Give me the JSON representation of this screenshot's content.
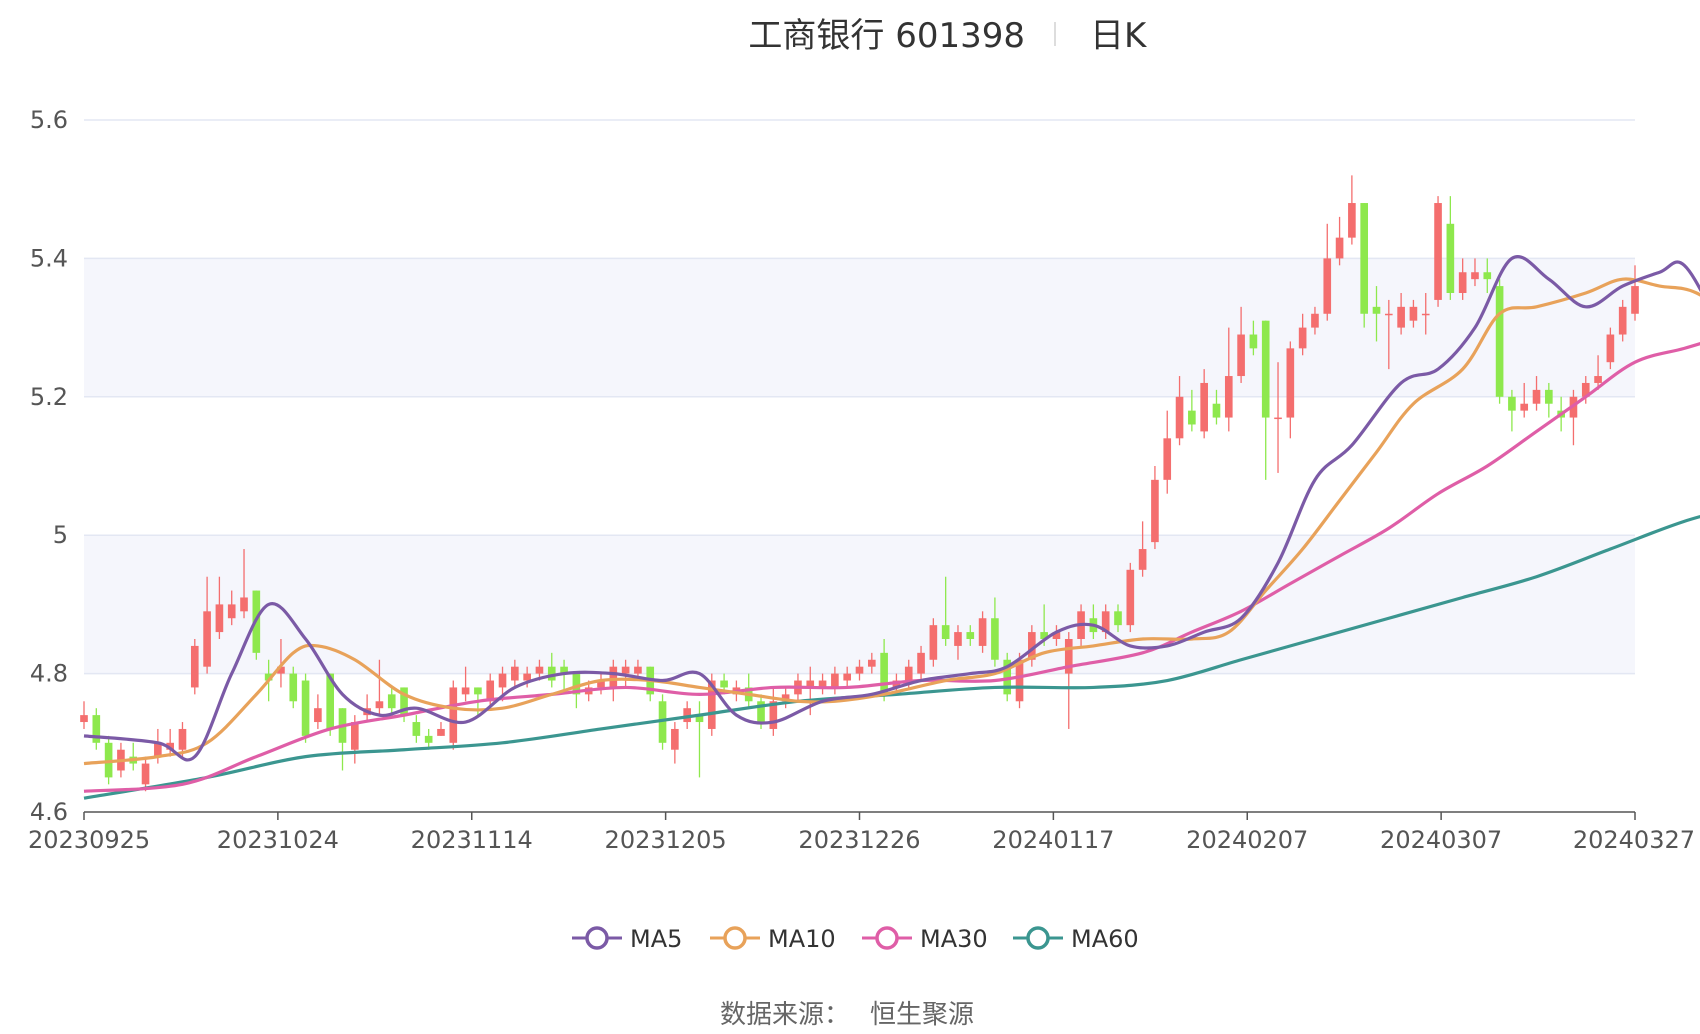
{
  "header": {
    "stock_name_code": "工商银行 601398",
    "period": "日K"
  },
  "footer": {
    "source_label": "数据来源：",
    "source_name": "恒生聚源"
  },
  "colors": {
    "up": "#f46e6e",
    "down": "#8ee84d",
    "grid": "#e3e7f3",
    "band": "#f5f6fc",
    "axis": "#555555",
    "MA5": "#7b5aa6",
    "MA10": "#e8a25a",
    "MA30": "#df5ea7",
    "MA60": "#3b9690"
  },
  "chart_data": {
    "type": "candlestick",
    "ylim": [
      4.6,
      5.6
    ],
    "y_ticks": [
      "4.6",
      "4.8",
      "5",
      "5.2",
      "5.4",
      "5.6"
    ],
    "x_ticks": [
      "20230925",
      "20231024",
      "20231114",
      "20231205",
      "20231226",
      "20240117",
      "20240207",
      "20240307",
      "20240327"
    ],
    "legend": [
      "MA5",
      "MA10",
      "MA30",
      "MA60"
    ],
    "legend_position": "bottom-center",
    "candles": [
      [
        4.73,
        4.74,
        4.72,
        4.76
      ],
      [
        4.74,
        4.7,
        4.69,
        4.75
      ],
      [
        4.7,
        4.65,
        4.64,
        4.71
      ],
      [
        4.66,
        4.69,
        4.65,
        4.7
      ],
      [
        4.68,
        4.67,
        4.66,
        4.7
      ],
      [
        4.64,
        4.67,
        4.63,
        4.68
      ],
      [
        4.68,
        4.7,
        4.67,
        4.72
      ],
      [
        4.69,
        4.7,
        4.68,
        4.72
      ],
      [
        4.69,
        4.72,
        4.68,
        4.73
      ],
      [
        4.78,
        4.84,
        4.77,
        4.85
      ],
      [
        4.81,
        4.89,
        4.8,
        4.94
      ],
      [
        4.86,
        4.9,
        4.85,
        4.94
      ],
      [
        4.88,
        4.9,
        4.87,
        4.92
      ],
      [
        4.89,
        4.91,
        4.88,
        4.98
      ],
      [
        4.92,
        4.83,
        4.82,
        4.92
      ],
      [
        4.8,
        4.79,
        4.76,
        4.82
      ],
      [
        4.8,
        4.81,
        4.78,
        4.85
      ],
      [
        4.8,
        4.76,
        4.75,
        4.81
      ],
      [
        4.79,
        4.71,
        4.7,
        4.8
      ],
      [
        4.73,
        4.75,
        4.72,
        4.77
      ],
      [
        4.8,
        4.72,
        4.71,
        4.8
      ],
      [
        4.75,
        4.7,
        4.66,
        4.75
      ],
      [
        4.69,
        4.73,
        4.67,
        4.74
      ],
      [
        4.74,
        4.75,
        4.73,
        4.77
      ],
      [
        4.75,
        4.76,
        4.74,
        4.82
      ],
      [
        4.77,
        4.75,
        4.74,
        4.78
      ],
      [
        4.78,
        4.74,
        4.73,
        4.78
      ],
      [
        4.73,
        4.71,
        4.7,
        4.74
      ],
      [
        4.71,
        4.7,
        4.69,
        4.72
      ],
      [
        4.71,
        4.72,
        4.71,
        4.73
      ],
      [
        4.7,
        4.78,
        4.69,
        4.79
      ],
      [
        4.77,
        4.78,
        4.76,
        4.81
      ],
      [
        4.78,
        4.77,
        4.74,
        4.78
      ],
      [
        4.76,
        4.79,
        4.75,
        4.8
      ],
      [
        4.78,
        4.8,
        4.76,
        4.81
      ],
      [
        4.79,
        4.81,
        4.78,
        4.82
      ],
      [
        4.79,
        4.8,
        4.78,
        4.81
      ],
      [
        4.8,
        4.81,
        4.79,
        4.82
      ],
      [
        4.81,
        4.79,
        4.78,
        4.83
      ],
      [
        4.81,
        4.8,
        4.77,
        4.82
      ],
      [
        4.8,
        4.77,
        4.75,
        4.8
      ],
      [
        4.77,
        4.78,
        4.76,
        4.79
      ],
      [
        4.78,
        4.79,
        4.77,
        4.8
      ],
      [
        4.78,
        4.81,
        4.76,
        4.82
      ],
      [
        4.8,
        4.81,
        4.78,
        4.82
      ],
      [
        4.8,
        4.81,
        4.79,
        4.82
      ],
      [
        4.81,
        4.77,
        4.76,
        4.81
      ],
      [
        4.76,
        4.7,
        4.69,
        4.77
      ],
      [
        4.69,
        4.72,
        4.67,
        4.73
      ],
      [
        4.73,
        4.75,
        4.72,
        4.76
      ],
      [
        4.74,
        4.73,
        4.65,
        4.76
      ],
      [
        4.72,
        4.79,
        4.71,
        4.8
      ],
      [
        4.79,
        4.78,
        4.77,
        4.8
      ],
      [
        4.77,
        4.78,
        4.76,
        4.79
      ],
      [
        4.78,
        4.76,
        4.75,
        4.8
      ],
      [
        4.76,
        4.73,
        4.72,
        4.77
      ],
      [
        4.72,
        4.76,
        4.71,
        4.78
      ],
      [
        4.76,
        4.77,
        4.75,
        4.78
      ],
      [
        4.77,
        4.79,
        4.76,
        4.8
      ],
      [
        4.78,
        4.79,
        4.74,
        4.81
      ],
      [
        4.78,
        4.79,
        4.77,
        4.8
      ],
      [
        4.78,
        4.8,
        4.77,
        4.81
      ],
      [
        4.79,
        4.8,
        4.78,
        4.81
      ],
      [
        4.8,
        4.81,
        4.79,
        4.82
      ],
      [
        4.81,
        4.82,
        4.8,
        4.83
      ],
      [
        4.83,
        4.77,
        4.76,
        4.85
      ],
      [
        4.78,
        4.79,
        4.77,
        4.8
      ],
      [
        4.79,
        4.81,
        4.78,
        4.82
      ],
      [
        4.8,
        4.83,
        4.79,
        4.84
      ],
      [
        4.82,
        4.87,
        4.81,
        4.88
      ],
      [
        4.87,
        4.85,
        4.84,
        4.94
      ],
      [
        4.84,
        4.86,
        4.82,
        4.87
      ],
      [
        4.86,
        4.85,
        4.84,
        4.87
      ],
      [
        4.84,
        4.88,
        4.83,
        4.89
      ],
      [
        4.88,
        4.82,
        4.81,
        4.91
      ],
      [
        4.82,
        4.77,
        4.76,
        4.83
      ],
      [
        4.76,
        4.82,
        4.75,
        4.83
      ],
      [
        4.82,
        4.86,
        4.81,
        4.87
      ],
      [
        4.86,
        4.85,
        4.84,
        4.9
      ],
      [
        4.85,
        4.86,
        4.84,
        4.87
      ],
      [
        4.8,
        4.85,
        4.72,
        4.86
      ],
      [
        4.85,
        4.89,
        4.84,
        4.9
      ],
      [
        4.88,
        4.86,
        4.85,
        4.9
      ],
      [
        4.86,
        4.89,
        4.85,
        4.9
      ],
      [
        4.89,
        4.87,
        4.86,
        4.9
      ],
      [
        4.87,
        4.95,
        4.86,
        4.96
      ],
      [
        4.95,
        4.98,
        4.94,
        5.02
      ],
      [
        4.99,
        5.08,
        4.98,
        5.1
      ],
      [
        5.08,
        5.14,
        5.06,
        5.18
      ],
      [
        5.14,
        5.2,
        5.13,
        5.23
      ],
      [
        5.18,
        5.16,
        5.15,
        5.21
      ],
      [
        5.15,
        5.22,
        5.14,
        5.24
      ],
      [
        5.19,
        5.17,
        5.16,
        5.21
      ],
      [
        5.17,
        5.23,
        5.15,
        5.3
      ],
      [
        5.23,
        5.29,
        5.22,
        5.33
      ],
      [
        5.29,
        5.27,
        5.26,
        5.31
      ],
      [
        5.31,
        5.17,
        5.08,
        5.31
      ],
      [
        5.17,
        5.17,
        5.09,
        5.25
      ],
      [
        5.17,
        5.27,
        5.14,
        5.28
      ],
      [
        5.27,
        5.3,
        5.26,
        5.32
      ],
      [
        5.3,
        5.32,
        5.29,
        5.33
      ],
      [
        5.32,
        5.4,
        5.31,
        5.45
      ],
      [
        5.4,
        5.43,
        5.39,
        5.46
      ],
      [
        5.43,
        5.48,
        5.42,
        5.52
      ],
      [
        5.48,
        5.32,
        5.3,
        5.48
      ],
      [
        5.33,
        5.32,
        5.28,
        5.36
      ],
      [
        5.32,
        5.32,
        5.24,
        5.34
      ],
      [
        5.3,
        5.33,
        5.29,
        5.35
      ],
      [
        5.31,
        5.33,
        5.3,
        5.34
      ],
      [
        5.32,
        5.32,
        5.29,
        5.35
      ],
      [
        5.34,
        5.48,
        5.33,
        5.49
      ],
      [
        5.45,
        5.35,
        5.34,
        5.49
      ],
      [
        5.35,
        5.38,
        5.34,
        5.4
      ],
      [
        5.37,
        5.38,
        5.36,
        5.4
      ],
      [
        5.38,
        5.37,
        5.35,
        5.4
      ],
      [
        5.36,
        5.2,
        5.19,
        5.37
      ],
      [
        5.2,
        5.18,
        5.15,
        5.21
      ],
      [
        5.18,
        5.19,
        5.17,
        5.22
      ],
      [
        5.19,
        5.21,
        5.18,
        5.23
      ],
      [
        5.21,
        5.19,
        5.17,
        5.22
      ],
      [
        5.18,
        5.17,
        5.15,
        5.2
      ],
      [
        5.17,
        5.2,
        5.13,
        5.21
      ],
      [
        5.2,
        5.22,
        5.19,
        5.23
      ],
      [
        5.22,
        5.23,
        5.21,
        5.26
      ],
      [
        5.25,
        5.29,
        5.24,
        5.3
      ],
      [
        5.29,
        5.33,
        5.28,
        5.34
      ],
      [
        5.32,
        5.36,
        5.31,
        5.39
      ]
    ],
    "MA5": [
      [
        0,
        4.71
      ],
      [
        6,
        4.7
      ],
      [
        9,
        4.68
      ],
      [
        12,
        4.8
      ],
      [
        15,
        4.9
      ],
      [
        18,
        4.85
      ],
      [
        21,
        4.77
      ],
      [
        24,
        4.74
      ],
      [
        27,
        4.75
      ],
      [
        31,
        4.73
      ],
      [
        35,
        4.78
      ],
      [
        39,
        4.8
      ],
      [
        43,
        4.8
      ],
      [
        47,
        4.79
      ],
      [
        50,
        4.8
      ],
      [
        53,
        4.74
      ],
      [
        56,
        4.73
      ],
      [
        60,
        4.76
      ],
      [
        64,
        4.77
      ],
      [
        68,
        4.79
      ],
      [
        72,
        4.8
      ],
      [
        75,
        4.81
      ],
      [
        79,
        4.86
      ],
      [
        82,
        4.87
      ],
      [
        85,
        4.84
      ],
      [
        88,
        4.84
      ],
      [
        91,
        4.86
      ],
      [
        94,
        4.88
      ],
      [
        97,
        4.96
      ],
      [
        100,
        5.08
      ],
      [
        103,
        5.13
      ],
      [
        107,
        5.22
      ],
      [
        110,
        5.24
      ],
      [
        113,
        5.3
      ],
      [
        116,
        5.4
      ],
      [
        119,
        5.37
      ],
      [
        122,
        5.33
      ],
      [
        125,
        5.36
      ],
      [
        128,
        5.38
      ],
      [
        130,
        5.39
      ],
      [
        133,
        5.3
      ],
      [
        137,
        5.18
      ],
      [
        140,
        5.18
      ],
      [
        143,
        5.2
      ],
      [
        146,
        5.29
      ]
    ],
    "MA10": [
      [
        0,
        4.67
      ],
      [
        6,
        4.68
      ],
      [
        10,
        4.7
      ],
      [
        14,
        4.77
      ],
      [
        17,
        4.83
      ],
      [
        19,
        4.84
      ],
      [
        22,
        4.82
      ],
      [
        26,
        4.77
      ],
      [
        30,
        4.75
      ],
      [
        34,
        4.75
      ],
      [
        38,
        4.77
      ],
      [
        42,
        4.79
      ],
      [
        46,
        4.79
      ],
      [
        50,
        4.78
      ],
      [
        54,
        4.77
      ],
      [
        58,
        4.76
      ],
      [
        61,
        4.76
      ],
      [
        65,
        4.77
      ],
      [
        70,
        4.79
      ],
      [
        74,
        4.8
      ],
      [
        78,
        4.83
      ],
      [
        82,
        4.84
      ],
      [
        86,
        4.85
      ],
      [
        90,
        4.85
      ],
      [
        93,
        4.86
      ],
      [
        96,
        4.92
      ],
      [
        99,
        4.98
      ],
      [
        102,
        5.05
      ],
      [
        105,
        5.12
      ],
      [
        108,
        5.19
      ],
      [
        112,
        5.24
      ],
      [
        115,
        5.32
      ],
      [
        118,
        5.33
      ],
      [
        122,
        5.35
      ],
      [
        125,
        5.37
      ],
      [
        128,
        5.36
      ],
      [
        131,
        5.35
      ],
      [
        135,
        5.3
      ],
      [
        138,
        5.26
      ],
      [
        141,
        5.22
      ],
      [
        144,
        5.2
      ],
      [
        146,
        5.24
      ]
    ],
    "MA30": [
      [
        0,
        4.63
      ],
      [
        8,
        4.64
      ],
      [
        14,
        4.68
      ],
      [
        20,
        4.72
      ],
      [
        26,
        4.74
      ],
      [
        32,
        4.76
      ],
      [
        38,
        4.77
      ],
      [
        44,
        4.78
      ],
      [
        50,
        4.77
      ],
      [
        56,
        4.78
      ],
      [
        62,
        4.78
      ],
      [
        68,
        4.79
      ],
      [
        74,
        4.79
      ],
      [
        80,
        4.81
      ],
      [
        86,
        4.83
      ],
      [
        90,
        4.86
      ],
      [
        94,
        4.89
      ],
      [
        98,
        4.93
      ],
      [
        102,
        4.97
      ],
      [
        106,
        5.01
      ],
      [
        110,
        5.06
      ],
      [
        114,
        5.1
      ],
      [
        118,
        5.15
      ],
      [
        122,
        5.2
      ],
      [
        126,
        5.25
      ],
      [
        130,
        5.27
      ],
      [
        134,
        5.29
      ],
      [
        138,
        5.3
      ],
      [
        142,
        5.3
      ],
      [
        146,
        5.3
      ]
    ],
    "MA60": [
      [
        0,
        4.62
      ],
      [
        10,
        4.65
      ],
      [
        18,
        4.68
      ],
      [
        26,
        4.69
      ],
      [
        34,
        4.7
      ],
      [
        42,
        4.72
      ],
      [
        50,
        4.74
      ],
      [
        58,
        4.76
      ],
      [
        66,
        4.77
      ],
      [
        74,
        4.78
      ],
      [
        82,
        4.78
      ],
      [
        88,
        4.79
      ],
      [
        94,
        4.82
      ],
      [
        100,
        4.85
      ],
      [
        106,
        4.88
      ],
      [
        112,
        4.91
      ],
      [
        118,
        4.94
      ],
      [
        124,
        4.98
      ],
      [
        130,
        5.02
      ],
      [
        136,
        5.05
      ],
      [
        142,
        5.09
      ],
      [
        146,
        5.12
      ]
    ]
  }
}
